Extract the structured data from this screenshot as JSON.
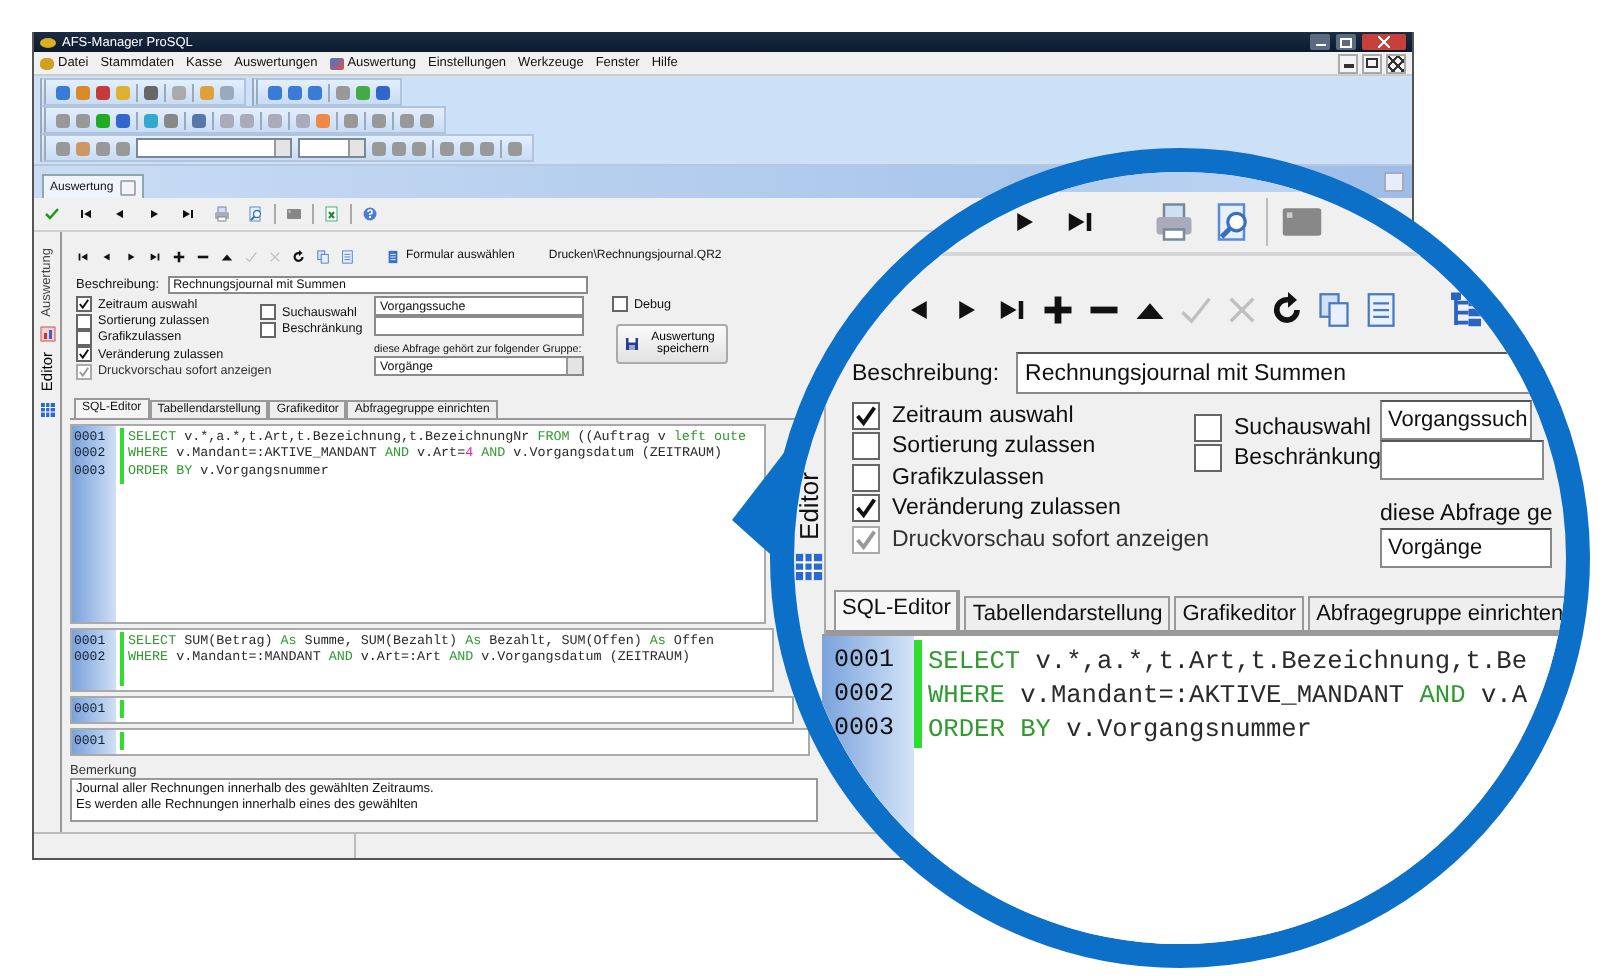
{
  "window": {
    "title": "AFS-Manager ProSQL"
  },
  "menu": [
    {
      "label": "Datei",
      "icon": true
    },
    {
      "label": "Stammdaten",
      "icon": false
    },
    {
      "label": "Kasse",
      "icon": false
    },
    {
      "label": "Auswertungen",
      "icon": false
    },
    {
      "label": "Auswertung",
      "icon": true
    },
    {
      "label": "Einstellungen",
      "icon": false
    },
    {
      "label": "Werkzeuge",
      "icon": false
    },
    {
      "label": "Fenster",
      "icon": false
    },
    {
      "label": "Hilfe",
      "icon": false
    }
  ],
  "document_tab": {
    "label": "Auswertung"
  },
  "side_tabs": [
    {
      "label": "Auswertung",
      "selected": false
    },
    {
      "label": "Editor",
      "selected": true
    }
  ],
  "form_toolbar": {
    "button": "Formular auswählen",
    "file": "Drucken\\Rechnungsjournal.QR2"
  },
  "form": {
    "description_label": "Beschreibung:",
    "description": "Rechnungsjournal mit Summen",
    "options": [
      {
        "label": "Zeitraum auswahl",
        "checked": true,
        "disabled": false
      },
      {
        "label": "Sortierung zulassen",
        "checked": false,
        "disabled": false
      },
      {
        "label": "Grafikzulassen",
        "checked": false,
        "disabled": false
      },
      {
        "label": "Veränderung zulassen",
        "checked": true,
        "disabled": false
      },
      {
        "label": "Druckvorschau sofort anzeigen",
        "checked": true,
        "disabled": true
      }
    ],
    "search_options": [
      {
        "label": "Suchauswahl",
        "checked": false
      },
      {
        "label": "Beschränkung",
        "checked": false
      }
    ],
    "search_value": "Vorgangssuche",
    "debug": {
      "label": "Debug",
      "checked": false
    },
    "group_label": "diese Abfrage gehört zur folgender Gruppe:",
    "group": "Vorgänge",
    "save_button": "Auswertung speichern"
  },
  "editor_tabs": [
    {
      "label": "SQL-Editor",
      "selected": true
    },
    {
      "label": "Tabellendarstellung",
      "selected": false
    },
    {
      "label": "Grafikeditor",
      "selected": false
    },
    {
      "label": "Abfragegruppe einrichten",
      "selected": false
    }
  ],
  "editors": [
    {
      "lines": [
        {
          "number": "0001",
          "tokens": [
            {
              "kind": "keyword",
              "text": "SELECT"
            },
            {
              "kind": "plain",
              "text": " v.*,a.*,t.Art,t.Bezeichnung,t.BezeichnungNr "
            },
            {
              "kind": "keyword",
              "text": "FROM"
            },
            {
              "kind": "plain",
              "text": " ((Auftrag v "
            },
            {
              "kind": "keyword",
              "text": "left oute"
            }
          ]
        },
        {
          "number": "0002",
          "tokens": [
            {
              "kind": "keyword",
              "text": "WHERE"
            },
            {
              "kind": "plain",
              "text": " v.Mandant=:AKTIVE_MANDANT "
            },
            {
              "kind": "keyword",
              "text": "AND"
            },
            {
              "kind": "plain",
              "text": " v.Art="
            },
            {
              "kind": "number",
              "text": "4"
            },
            {
              "kind": "keyword",
              "text": " AND"
            },
            {
              "kind": "plain",
              "text": " v.Vorgangsdatum (ZEITRAUM)"
            }
          ]
        },
        {
          "number": "0003",
          "tokens": [
            {
              "kind": "keyword",
              "text": "ORDER BY"
            },
            {
              "kind": "plain",
              "text": " v.Vorgangsnummer"
            }
          ]
        }
      ]
    },
    {
      "lines": [
        {
          "number": "0001",
          "tokens": [
            {
              "kind": "keyword",
              "text": "SELECT"
            },
            {
              "kind": "plain",
              "text": " SUM(Betrag) "
            },
            {
              "kind": "keyword",
              "text": "As"
            },
            {
              "kind": "plain",
              "text": " Summe, SUM(Bezahlt) "
            },
            {
              "kind": "keyword",
              "text": "As"
            },
            {
              "kind": "plain",
              "text": " Bezahlt, SUM(Offen) "
            },
            {
              "kind": "keyword",
              "text": "As"
            },
            {
              "kind": "plain",
              "text": " Offen"
            }
          ]
        },
        {
          "number": "0002",
          "tokens": [
            {
              "kind": "keyword",
              "text": "WHERE"
            },
            {
              "kind": "plain",
              "text": " v.Mandant=:MANDANT "
            },
            {
              "kind": "keyword",
              "text": "AND"
            },
            {
              "kind": "plain",
              "text": " v.Art=:Art "
            },
            {
              "kind": "keyword",
              "text": "AND"
            },
            {
              "kind": "plain",
              "text": " v.Vorgangsdatum (ZEITRAUM)"
            }
          ]
        }
      ]
    },
    {
      "lines": [
        {
          "number": "0001"
        }
      ]
    },
    {
      "lines": [
        {
          "number": "0001"
        }
      ]
    }
  ],
  "remark": {
    "label": "Bemerkung",
    "lines": [
      "Journal aller Rechnungen innerhalb des gewählten Zeitraums.",
      "Es werden alle Rechnungen innerhalb eines des gewählten"
    ]
  },
  "magnifier": {
    "side_tab": "Editor",
    "description_label": "Beschreibung:",
    "description": "Rechnungsjournal mit Summen",
    "options": [
      {
        "label": "Zeitraum auswahl",
        "checked": true,
        "disabled": false
      },
      {
        "label": "Sortierung zulassen",
        "checked": false,
        "disabled": false
      },
      {
        "label": "Grafikzulassen",
        "checked": false,
        "disabled": false
      },
      {
        "label": "Veränderung zulassen",
        "checked": true,
        "disabled": false
      },
      {
        "label": "Druckvorschau sofort anzeigen",
        "checked": true,
        "disabled": true
      }
    ],
    "search_options": [
      {
        "label": "Suchauswahl",
        "checked": false
      },
      {
        "label": "Beschränkung",
        "checked": false
      }
    ],
    "search_value": "Vorgangssuch",
    "group_label": "diese Abfrage ge",
    "group": "Vorgänge",
    "tabs": [
      {
        "label": "SQL-Editor",
        "selected": true
      },
      {
        "label": "Tabellendarstellung",
        "selected": false
      },
      {
        "label": "Grafikeditor",
        "selected": false
      },
      {
        "label": "Abfragegruppe einrichten",
        "selected": false
      }
    ],
    "lines": [
      {
        "number": "0001",
        "tokens": [
          {
            "kind": "keyword",
            "text": "SELECT"
          },
          {
            "kind": "plain",
            "text": " v.*,a.*,t.Art,t.Bezeichnung,t.Be"
          }
        ]
      },
      {
        "number": "0002",
        "tokens": [
          {
            "kind": "keyword",
            "text": "WHERE"
          },
          {
            "kind": "plain",
            "text": " v.Mandant=:AKTIVE_MANDANT "
          },
          {
            "kind": "keyword",
            "text": "AND"
          },
          {
            "kind": "plain",
            "text": " v.A"
          }
        ]
      },
      {
        "number": "0003",
        "tokens": [
          {
            "kind": "keyword",
            "text": "ORDER BY"
          },
          {
            "kind": "plain",
            "text": " v.Vorgangsnummer"
          }
        ]
      }
    ]
  }
}
